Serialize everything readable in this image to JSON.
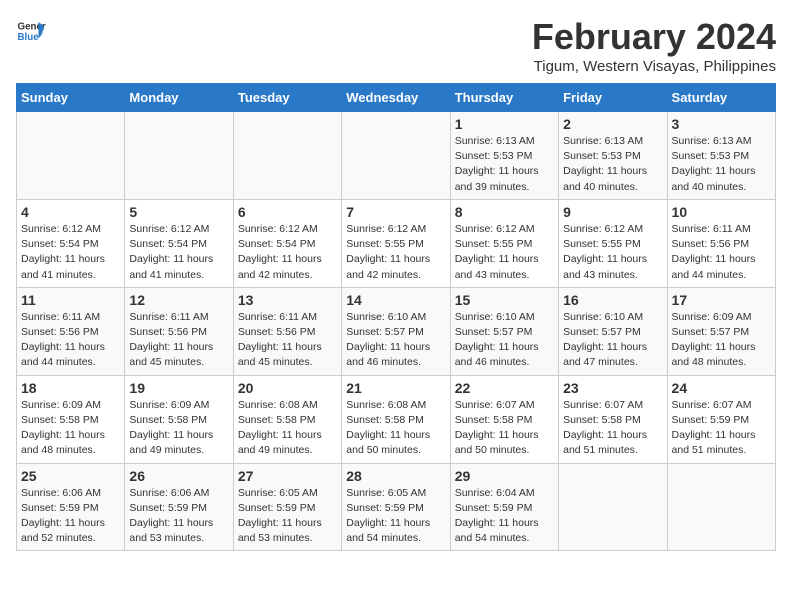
{
  "header": {
    "logo_line1": "General",
    "logo_line2": "Blue",
    "month_year": "February 2024",
    "location": "Tigum, Western Visayas, Philippines"
  },
  "weekdays": [
    "Sunday",
    "Monday",
    "Tuesday",
    "Wednesday",
    "Thursday",
    "Friday",
    "Saturday"
  ],
  "weeks": [
    [
      {
        "day": "",
        "info": ""
      },
      {
        "day": "",
        "info": ""
      },
      {
        "day": "",
        "info": ""
      },
      {
        "day": "",
        "info": ""
      },
      {
        "day": "1",
        "info": "Sunrise: 6:13 AM\nSunset: 5:53 PM\nDaylight: 11 hours\nand 39 minutes."
      },
      {
        "day": "2",
        "info": "Sunrise: 6:13 AM\nSunset: 5:53 PM\nDaylight: 11 hours\nand 40 minutes."
      },
      {
        "day": "3",
        "info": "Sunrise: 6:13 AM\nSunset: 5:53 PM\nDaylight: 11 hours\nand 40 minutes."
      }
    ],
    [
      {
        "day": "4",
        "info": "Sunrise: 6:12 AM\nSunset: 5:54 PM\nDaylight: 11 hours\nand 41 minutes."
      },
      {
        "day": "5",
        "info": "Sunrise: 6:12 AM\nSunset: 5:54 PM\nDaylight: 11 hours\nand 41 minutes."
      },
      {
        "day": "6",
        "info": "Sunrise: 6:12 AM\nSunset: 5:54 PM\nDaylight: 11 hours\nand 42 minutes."
      },
      {
        "day": "7",
        "info": "Sunrise: 6:12 AM\nSunset: 5:55 PM\nDaylight: 11 hours\nand 42 minutes."
      },
      {
        "day": "8",
        "info": "Sunrise: 6:12 AM\nSunset: 5:55 PM\nDaylight: 11 hours\nand 43 minutes."
      },
      {
        "day": "9",
        "info": "Sunrise: 6:12 AM\nSunset: 5:55 PM\nDaylight: 11 hours\nand 43 minutes."
      },
      {
        "day": "10",
        "info": "Sunrise: 6:11 AM\nSunset: 5:56 PM\nDaylight: 11 hours\nand 44 minutes."
      }
    ],
    [
      {
        "day": "11",
        "info": "Sunrise: 6:11 AM\nSunset: 5:56 PM\nDaylight: 11 hours\nand 44 minutes."
      },
      {
        "day": "12",
        "info": "Sunrise: 6:11 AM\nSunset: 5:56 PM\nDaylight: 11 hours\nand 45 minutes."
      },
      {
        "day": "13",
        "info": "Sunrise: 6:11 AM\nSunset: 5:56 PM\nDaylight: 11 hours\nand 45 minutes."
      },
      {
        "day": "14",
        "info": "Sunrise: 6:10 AM\nSunset: 5:57 PM\nDaylight: 11 hours\nand 46 minutes."
      },
      {
        "day": "15",
        "info": "Sunrise: 6:10 AM\nSunset: 5:57 PM\nDaylight: 11 hours\nand 46 minutes."
      },
      {
        "day": "16",
        "info": "Sunrise: 6:10 AM\nSunset: 5:57 PM\nDaylight: 11 hours\nand 47 minutes."
      },
      {
        "day": "17",
        "info": "Sunrise: 6:09 AM\nSunset: 5:57 PM\nDaylight: 11 hours\nand 48 minutes."
      }
    ],
    [
      {
        "day": "18",
        "info": "Sunrise: 6:09 AM\nSunset: 5:58 PM\nDaylight: 11 hours\nand 48 minutes."
      },
      {
        "day": "19",
        "info": "Sunrise: 6:09 AM\nSunset: 5:58 PM\nDaylight: 11 hours\nand 49 minutes."
      },
      {
        "day": "20",
        "info": "Sunrise: 6:08 AM\nSunset: 5:58 PM\nDaylight: 11 hours\nand 49 minutes."
      },
      {
        "day": "21",
        "info": "Sunrise: 6:08 AM\nSunset: 5:58 PM\nDaylight: 11 hours\nand 50 minutes."
      },
      {
        "day": "22",
        "info": "Sunrise: 6:07 AM\nSunset: 5:58 PM\nDaylight: 11 hours\nand 50 minutes."
      },
      {
        "day": "23",
        "info": "Sunrise: 6:07 AM\nSunset: 5:58 PM\nDaylight: 11 hours\nand 51 minutes."
      },
      {
        "day": "24",
        "info": "Sunrise: 6:07 AM\nSunset: 5:59 PM\nDaylight: 11 hours\nand 51 minutes."
      }
    ],
    [
      {
        "day": "25",
        "info": "Sunrise: 6:06 AM\nSunset: 5:59 PM\nDaylight: 11 hours\nand 52 minutes."
      },
      {
        "day": "26",
        "info": "Sunrise: 6:06 AM\nSunset: 5:59 PM\nDaylight: 11 hours\nand 53 minutes."
      },
      {
        "day": "27",
        "info": "Sunrise: 6:05 AM\nSunset: 5:59 PM\nDaylight: 11 hours\nand 53 minutes."
      },
      {
        "day": "28",
        "info": "Sunrise: 6:05 AM\nSunset: 5:59 PM\nDaylight: 11 hours\nand 54 minutes."
      },
      {
        "day": "29",
        "info": "Sunrise: 6:04 AM\nSunset: 5:59 PM\nDaylight: 11 hours\nand 54 minutes."
      },
      {
        "day": "",
        "info": ""
      },
      {
        "day": "",
        "info": ""
      }
    ]
  ]
}
